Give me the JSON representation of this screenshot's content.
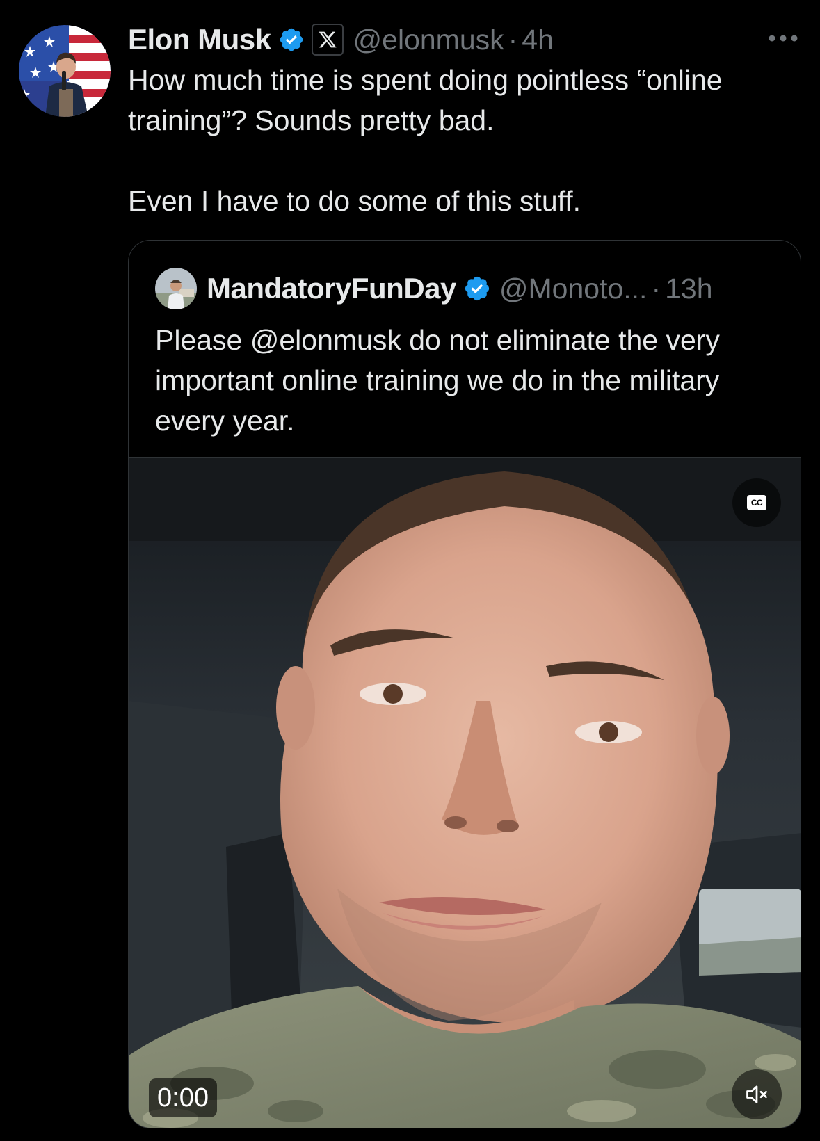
{
  "tweet": {
    "display_name": "Elon Musk",
    "handle": "@elonmusk",
    "separator": "·",
    "time": "4h",
    "text": "How much time is spent doing pointless “online training”? Sounds pretty bad.\n\nEven I have to do some of this stuff.",
    "avatar_icon": "profile-photo-flag-background",
    "verified_icon": "verified-badge-icon",
    "affiliation_icon": "x-logo-icon",
    "more_icon": "more-options-icon"
  },
  "quoted_tweet": {
    "display_name": "MandatoryFunDay",
    "handle": "@Monoto...",
    "separator": "·",
    "time": "13h",
    "text": "Please @elonmusk do not eliminate the very important online training we do in the military every year.",
    "verified_icon": "verified-badge-icon"
  },
  "video": {
    "timer": "0:00",
    "cc_label": "CC",
    "cc_icon": "closed-captions-icon",
    "mute_icon": "volume-muted-icon"
  },
  "colors": {
    "background": "#000000",
    "text_primary": "#e7e9ea",
    "text_secondary": "#71767b",
    "verified_blue": "#1d9bf0",
    "border": "#2f3336"
  }
}
